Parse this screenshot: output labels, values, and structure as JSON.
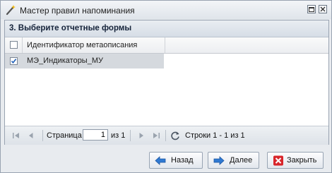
{
  "window": {
    "title": "Мастер правил напоминания",
    "icon": "magic-wand-icon"
  },
  "step": {
    "title": "3. Выберите отчетные формы"
  },
  "grid": {
    "column_header": "Идентификатор метаописания",
    "header_checked": false,
    "rows": [
      {
        "label": "МЭ_Индикаторы_МУ",
        "checked": true
      }
    ]
  },
  "pager": {
    "page_label": "Страница",
    "page_value": "1",
    "of_label": "из 1",
    "rows_label": "Строки 1 - 1 из 1"
  },
  "buttons": {
    "back": "Назад",
    "next": "Далее",
    "close": "Закрыть"
  },
  "colors": {
    "accent_blue": "#2f79d2",
    "close_red": "#d8262b",
    "selected_row": "#d5d9de"
  }
}
